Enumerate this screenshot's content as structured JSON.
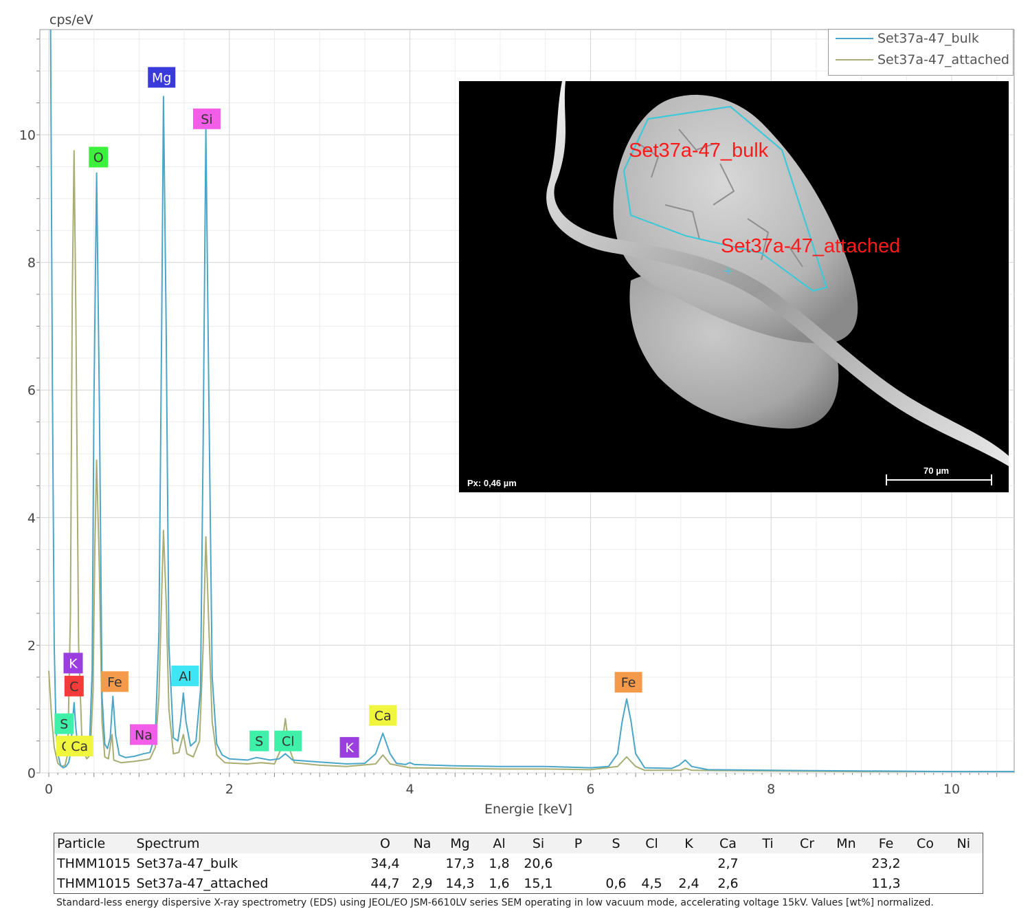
{
  "chart_data": {
    "type": "line",
    "ylabel": "cps/eV",
    "xlabel": "Energie [keV]",
    "xlim": [
      -0.1,
      10.7
    ],
    "ylim": [
      0,
      11.7
    ],
    "xticks": [
      0,
      2,
      4,
      6,
      8,
      10
    ],
    "yticks": [
      0,
      2,
      4,
      6,
      8,
      10
    ],
    "grid": true,
    "legend_position": "top-right",
    "series": [
      {
        "name": "Set37a-47_bulk",
        "color": "#4aa6c8",
        "points": [
          [
            0.0,
            11.7
          ],
          [
            0.02,
            11.7
          ],
          [
            0.04,
            6.0
          ],
          [
            0.06,
            2.0
          ],
          [
            0.08,
            0.7
          ],
          [
            0.1,
            0.3
          ],
          [
            0.13,
            0.12
          ],
          [
            0.16,
            0.08
          ],
          [
            0.19,
            0.1
          ],
          [
            0.22,
            0.16
          ],
          [
            0.24,
            0.3
          ],
          [
            0.26,
            0.75
          ],
          [
            0.28,
            1.1
          ],
          [
            0.3,
            0.7
          ],
          [
            0.33,
            0.32
          ],
          [
            0.37,
            0.28
          ],
          [
            0.41,
            0.3
          ],
          [
            0.45,
            0.38
          ],
          [
            0.48,
            1.6
          ],
          [
            0.5,
            5.8
          ],
          [
            0.53,
            9.4
          ],
          [
            0.56,
            5.8
          ],
          [
            0.59,
            1.2
          ],
          [
            0.62,
            0.45
          ],
          [
            0.65,
            0.38
          ],
          [
            0.68,
            0.55
          ],
          [
            0.71,
            1.2
          ],
          [
            0.74,
            0.6
          ],
          [
            0.78,
            0.28
          ],
          [
            0.85,
            0.24
          ],
          [
            0.95,
            0.26
          ],
          [
            1.05,
            0.3
          ],
          [
            1.12,
            0.32
          ],
          [
            1.18,
            0.6
          ],
          [
            1.22,
            2.2
          ],
          [
            1.25,
            7.0
          ],
          [
            1.27,
            10.6
          ],
          [
            1.3,
            7.0
          ],
          [
            1.33,
            2.0
          ],
          [
            1.38,
            0.55
          ],
          [
            1.43,
            0.5
          ],
          [
            1.46,
            0.8
          ],
          [
            1.49,
            1.25
          ],
          [
            1.52,
            0.8
          ],
          [
            1.57,
            0.42
          ],
          [
            1.63,
            0.5
          ],
          [
            1.68,
            1.3
          ],
          [
            1.71,
            5.2
          ],
          [
            1.74,
            10.1
          ],
          [
            1.77,
            6.2
          ],
          [
            1.81,
            1.5
          ],
          [
            1.86,
            0.45
          ],
          [
            1.92,
            0.28
          ],
          [
            2.0,
            0.22
          ],
          [
            2.2,
            0.2
          ],
          [
            2.3,
            0.24
          ],
          [
            2.45,
            0.2
          ],
          [
            2.55,
            0.22
          ],
          [
            2.62,
            0.3
          ],
          [
            2.7,
            0.2
          ],
          [
            3.0,
            0.17
          ],
          [
            3.3,
            0.14
          ],
          [
            3.5,
            0.15
          ],
          [
            3.62,
            0.3
          ],
          [
            3.7,
            0.62
          ],
          [
            3.78,
            0.3
          ],
          [
            3.85,
            0.15
          ],
          [
            3.95,
            0.13
          ],
          [
            4.0,
            0.16
          ],
          [
            4.05,
            0.13
          ],
          [
            4.5,
            0.11
          ],
          [
            5.0,
            0.1
          ],
          [
            5.5,
            0.1
          ],
          [
            6.0,
            0.08
          ],
          [
            6.2,
            0.1
          ],
          [
            6.3,
            0.3
          ],
          [
            6.35,
            0.8
          ],
          [
            6.4,
            1.16
          ],
          [
            6.45,
            0.8
          ],
          [
            6.5,
            0.3
          ],
          [
            6.6,
            0.08
          ],
          [
            6.9,
            0.07
          ],
          [
            6.98,
            0.12
          ],
          [
            7.05,
            0.2
          ],
          [
            7.12,
            0.1
          ],
          [
            7.3,
            0.05
          ],
          [
            8.0,
            0.04
          ],
          [
            9.0,
            0.03
          ],
          [
            10.0,
            0.02
          ],
          [
            10.7,
            0.02
          ]
        ]
      },
      {
        "name": "Set37a-47_attached",
        "color": "#a8ad72",
        "points": [
          [
            0.0,
            1.6
          ],
          [
            0.03,
            0.9
          ],
          [
            0.06,
            0.4
          ],
          [
            0.1,
            0.15
          ],
          [
            0.14,
            0.1
          ],
          [
            0.18,
            0.12
          ],
          [
            0.21,
            0.3
          ],
          [
            0.24,
            2.5
          ],
          [
            0.26,
            7.5
          ],
          [
            0.28,
            9.75
          ],
          [
            0.3,
            7.2
          ],
          [
            0.33,
            2.0
          ],
          [
            0.37,
            0.4
          ],
          [
            0.42,
            0.22
          ],
          [
            0.46,
            0.28
          ],
          [
            0.49,
            1.3
          ],
          [
            0.51,
            3.5
          ],
          [
            0.53,
            4.9
          ],
          [
            0.56,
            3.2
          ],
          [
            0.59,
            0.8
          ],
          [
            0.62,
            0.25
          ],
          [
            0.66,
            0.22
          ],
          [
            0.7,
            0.6
          ],
          [
            0.72,
            0.2
          ],
          [
            0.8,
            0.16
          ],
          [
            0.95,
            0.18
          ],
          [
            1.05,
            0.2
          ],
          [
            1.12,
            0.22
          ],
          [
            1.18,
            0.4
          ],
          [
            1.22,
            1.2
          ],
          [
            1.25,
            2.8
          ],
          [
            1.27,
            3.8
          ],
          [
            1.3,
            2.7
          ],
          [
            1.33,
            1.0
          ],
          [
            1.38,
            0.3
          ],
          [
            1.44,
            0.32
          ],
          [
            1.49,
            0.6
          ],
          [
            1.53,
            0.3
          ],
          [
            1.6,
            0.25
          ],
          [
            1.67,
            0.5
          ],
          [
            1.71,
            2.0
          ],
          [
            1.74,
            3.7
          ],
          [
            1.77,
            2.4
          ],
          [
            1.81,
            0.8
          ],
          [
            1.86,
            0.28
          ],
          [
            1.95,
            0.16
          ],
          [
            2.2,
            0.14
          ],
          [
            2.35,
            0.16
          ],
          [
            2.5,
            0.14
          ],
          [
            2.58,
            0.4
          ],
          [
            2.62,
            0.85
          ],
          [
            2.66,
            0.4
          ],
          [
            2.72,
            0.16
          ],
          [
            3.0,
            0.12
          ],
          [
            3.3,
            0.1
          ],
          [
            3.62,
            0.14
          ],
          [
            3.7,
            0.28
          ],
          [
            3.78,
            0.14
          ],
          [
            4.0,
            0.08
          ],
          [
            4.5,
            0.07
          ],
          [
            5.0,
            0.06
          ],
          [
            5.5,
            0.06
          ],
          [
            6.0,
            0.05
          ],
          [
            6.3,
            0.1
          ],
          [
            6.4,
            0.25
          ],
          [
            6.5,
            0.1
          ],
          [
            6.6,
            0.04
          ],
          [
            7.0,
            0.04
          ],
          [
            7.05,
            0.07
          ],
          [
            7.12,
            0.04
          ],
          [
            8.0,
            0.03
          ],
          [
            9.0,
            0.02
          ],
          [
            10.0,
            0.02
          ],
          [
            10.7,
            0.02
          ]
        ]
      }
    ],
    "peak_labels": [
      {
        "text": "Mg",
        "x": 1.25,
        "y": 10.9,
        "color": "#3a3adc",
        "text_color": "#ffffff"
      },
      {
        "text": "Si",
        "x": 1.75,
        "y": 10.25,
        "color": "#f25ee8",
        "text_color": "#333333"
      },
      {
        "text": "O",
        "x": 0.55,
        "y": 9.65,
        "color": "#3ef03e",
        "text_color": "#333333"
      },
      {
        "text": "K",
        "x": 0.27,
        "y": 1.72,
        "color": "#9a3ee0",
        "text_color": "#ffffff"
      },
      {
        "text": "C",
        "x": 0.28,
        "y": 1.36,
        "color": "#f53a3a",
        "text_color": "#333333"
      },
      {
        "text": "Fe",
        "x": 0.73,
        "y": 1.43,
        "color": "#f59a4a",
        "text_color": "#333333"
      },
      {
        "text": "Al",
        "x": 1.51,
        "y": 1.52,
        "color": "#3ee6f5",
        "text_color": "#333333"
      },
      {
        "text": "S",
        "x": 0.17,
        "y": 0.77,
        "color": "#3ef0a8",
        "text_color": "#333333"
      },
      {
        "text": "C",
        "x": 0.19,
        "y": 0.42,
        "color": "#f0f53e",
        "text_color": "#333333"
      },
      {
        "text": "Ca",
        "x": 0.34,
        "y": 0.42,
        "color": "#f0f53e",
        "text_color": "#333333"
      },
      {
        "text": "Na",
        "x": 1.05,
        "y": 0.6,
        "color": "#f25ee8",
        "text_color": "#333333"
      },
      {
        "text": "S",
        "x": 2.33,
        "y": 0.5,
        "color": "#3ef0a8",
        "text_color": "#333333"
      },
      {
        "text": "Cl",
        "x": 2.65,
        "y": 0.5,
        "color": "#3ef0a8",
        "text_color": "#333333"
      },
      {
        "text": "K",
        "x": 3.33,
        "y": 0.4,
        "color": "#9a3ee0",
        "text_color": "#ffffff"
      },
      {
        "text": "Ca",
        "x": 3.7,
        "y": 0.9,
        "color": "#f0f53e",
        "text_color": "#333333"
      },
      {
        "text": "Fe",
        "x": 6.42,
        "y": 1.42,
        "color": "#f59a4a",
        "text_color": "#333333"
      }
    ]
  },
  "inset": {
    "label_bulk": "Set37a-47_bulk",
    "label_attached": "Set37a-47_attached",
    "pixel_size": "Px: 0,46 µm",
    "scale_bar": "70 µm",
    "label_color": "#ff1a1a",
    "outline_color": "#3ec8d8"
  },
  "table": {
    "headers": [
      "Particle",
      "Spectrum",
      "O",
      "Na",
      "Mg",
      "Al",
      "Si",
      "P",
      "S",
      "Cl",
      "K",
      "Ca",
      "Ti",
      "Cr",
      "Mn",
      "Fe",
      "Co",
      "Ni"
    ],
    "rows": [
      [
        "THMM1015",
        "Set37a-47_bulk",
        "34,4",
        "",
        "17,3",
        "1,8",
        "20,6",
        "",
        "",
        "",
        "",
        "2,7",
        "",
        "",
        "",
        "23,2",
        "",
        ""
      ],
      [
        "THMM1015",
        "Set37a-47_attached",
        "44,7",
        "2,9",
        "14,3",
        "1,6",
        "15,1",
        "",
        "0,6",
        "4,5",
        "2,4",
        "2,6",
        "",
        "",
        "",
        "11,3",
        "",
        ""
      ]
    ]
  },
  "footnote": "Standard-less energy dispersive X-ray spectrometry (EDS) using JEOL/EO JSM-6610LV series SEM operating in low vacuum mode, accelerating voltage 15kV. Values [wt%] normalized."
}
